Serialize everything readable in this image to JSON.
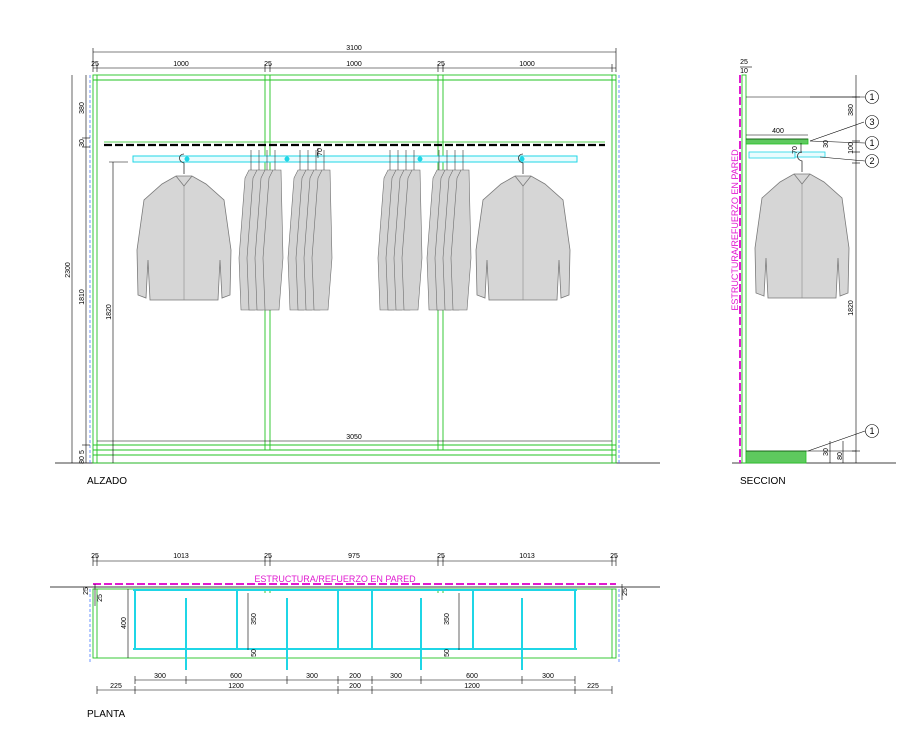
{
  "views": {
    "alzado": {
      "label": "ALZADO",
      "top_dims": [
        "3100",
        "25",
        "1000",
        "25",
        "1000",
        "25",
        "1000"
      ],
      "left_dims": [
        "380",
        "30",
        "2300",
        "1810",
        "1820",
        "5",
        "80"
      ],
      "bottom_dim": "3050",
      "rail_dim": "70"
    },
    "seccion": {
      "label": "SECCION",
      "top_dims": [
        "25",
        "10"
      ],
      "shelf_dim": "400",
      "right_dims": [
        "380",
        "30",
        "100",
        "1820",
        "30",
        "80"
      ],
      "rail_dim": "70",
      "wall_text": "ESTRUCTURA/REFUERZO EN PARED",
      "callouts": [
        "1",
        "3",
        "1",
        "2",
        "1"
      ]
    },
    "planta": {
      "label": "PLANTA",
      "top_dims": [
        "25",
        "1013",
        "25",
        "975",
        "25",
        "1013",
        "25"
      ],
      "wall_text": "ESTRUCTURA/REFUERZO EN PARED",
      "side_dims": [
        "25",
        "25",
        "400",
        "350",
        "50",
        "350",
        "50",
        "25"
      ],
      "bottom_row1": [
        "300",
        "600",
        "300",
        "200",
        "300",
        "600",
        "300"
      ],
      "bottom_row2": [
        "225",
        "1200",
        "200",
        "1200",
        "225"
      ]
    }
  },
  "colors": {
    "frame": "#22c322",
    "rail": "#1fd6e6",
    "wall": "#e01ad0",
    "shirt": "#d6d6d6",
    "line": "#000000"
  }
}
